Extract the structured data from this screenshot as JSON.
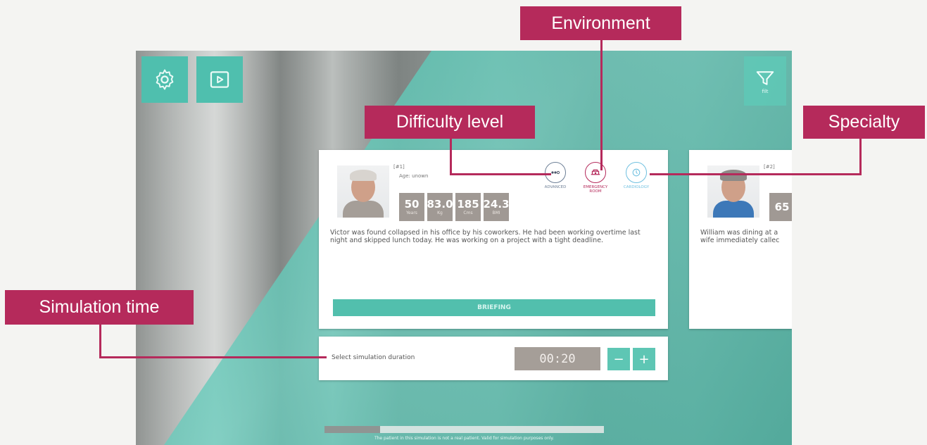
{
  "callouts": {
    "environment": "Environment",
    "difficulty": "Difficulty level",
    "specialty": "Specialty",
    "simulation_time": "Simulation time"
  },
  "toolbar": {
    "settings_icon": "gear-icon",
    "video_icon": "play-video-icon",
    "filter_icon": "filter-icon",
    "filter_caption": "filt"
  },
  "cards": [
    {
      "id_line": "[#1]",
      "sub_line": "Age: unown",
      "stats": [
        {
          "value": "50",
          "unit": "Years"
        },
        {
          "value": "83.0",
          "unit": "Kg"
        },
        {
          "value": "185",
          "unit": "Cms"
        },
        {
          "value": "24.3",
          "unit": "BMI"
        }
      ],
      "attributes": [
        {
          "icon": "difficulty-icon",
          "caption": "ADVANCED",
          "color": "#6d7f96"
        },
        {
          "icon": "environment-icon",
          "caption": "EMERGENCY ROOM",
          "color": "#b52a5b"
        },
        {
          "icon": "specialty-icon",
          "caption": "CARDIOLOGY",
          "color": "#6fc0e0"
        }
      ],
      "description": "Victor was found collapsed in his office by his coworkers. He had been working overtime last night and skipped lunch today. He was working on a project with a tight deadline.",
      "briefing_label": "BRIEFING"
    },
    {
      "id_line": "[#2]",
      "stat_value": "65",
      "description": "William was dining at a wife immediately callec"
    }
  ],
  "duration": {
    "label": "Select simulation duration",
    "value": "00:20",
    "minus": "−",
    "plus": "+"
  },
  "progress": {
    "fraction": 0.2
  },
  "disclaimer": "The patient in this simulation is not a real patient. Valid for simulation purposes only."
}
